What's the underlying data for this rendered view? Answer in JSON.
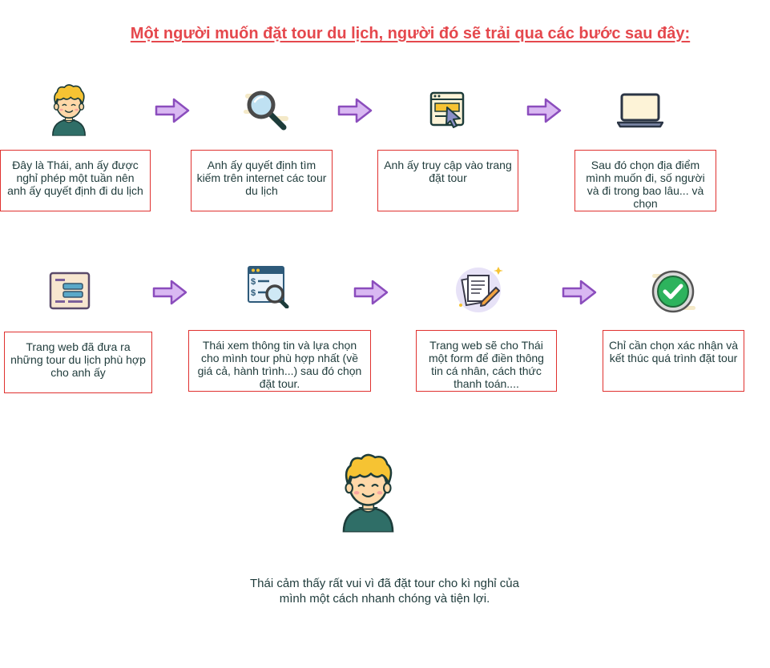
{
  "title": "Một người muốn đặt tour du lịch, người đó sẽ trải qua các bước sau đây:",
  "colors": {
    "title": "#e5484d",
    "box_border": "#e0312f",
    "arrow_fill": "#d9b8f2",
    "arrow_stroke": "#8b4dbd",
    "hair": "#f6c333",
    "skin": "#ffd8a8",
    "shirt": "#2f6e67"
  },
  "steps": [
    {
      "text": "Đây là Thái, anh ấy được nghỉ phép một tuần nên anh ấy quyết định đi du lịch",
      "icon": "boy-avatar-icon"
    },
    {
      "text": "Anh ấy quyết định tìm kiếm trên internet các tour du lịch",
      "icon": "magnifier-icon"
    },
    {
      "text": "Anh ấy truy cập vào trang đặt tour",
      "icon": "browser-cursor-icon"
    },
    {
      "text": "Sau đó chọn địa điểm mình muốn đi, số người và đi trong bao lâu... và chọn",
      "icon": "laptop-icon"
    },
    {
      "text": "Trang web đã đưa ra những tour du lịch phù hợp cho anh ấy",
      "icon": "document-list-icon"
    },
    {
      "text": "Thái xem thông tin và lựa chọn cho mình tour phù hợp nhất (về giá cả, hành trình...) sau đó chọn đặt tour.",
      "icon": "price-search-icon"
    },
    {
      "text": "Trang web sẽ cho Thái một form để điền thông tin cá nhân, cách thức thanh toán....",
      "icon": "form-pencil-icon"
    },
    {
      "text": "Chỉ cần chọn xác nhận và kết thúc quá trình đặt tour",
      "icon": "checkmark-icon"
    }
  ],
  "final": {
    "caption": "Thái cảm thấy rất vui vì đã đặt tour cho kì nghỉ của mình một cách nhanh chóng và tiện lợi.",
    "icon": "happy-boy-icon"
  }
}
